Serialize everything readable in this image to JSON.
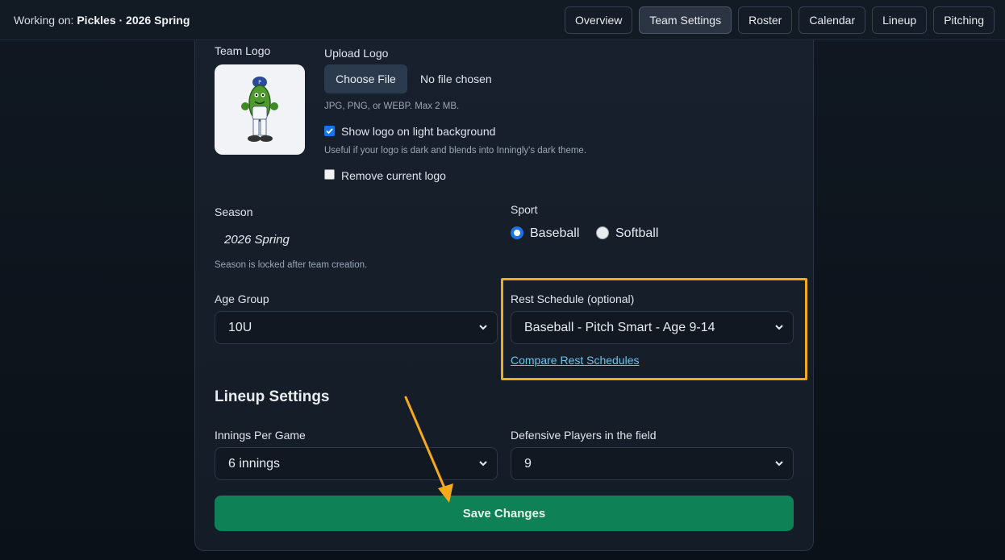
{
  "topbar": {
    "working_prefix": "Working on: ",
    "working_team": "Pickles · 2026 Spring",
    "nav": [
      {
        "label": "Overview",
        "active": false
      },
      {
        "label": "Team Settings",
        "active": true
      },
      {
        "label": "Roster",
        "active": false
      },
      {
        "label": "Calendar",
        "active": false
      },
      {
        "label": "Lineup",
        "active": false
      },
      {
        "label": "Pitching",
        "active": false
      }
    ]
  },
  "logo": {
    "label": "Team Logo",
    "upload_label": "Upload Logo",
    "choose_button": "Choose File",
    "file_status": "No file chosen",
    "formats_help": "JPG, PNG, or WEBP. Max 2 MB.",
    "light_bg_label": "Show logo on light background",
    "light_bg_checked": true,
    "light_bg_help": "Useful if your logo is dark and blends into Inningly's dark theme.",
    "remove_label": "Remove current logo",
    "remove_checked": false
  },
  "season": {
    "label": "Season",
    "value": "2026 Spring",
    "help": "Season is locked after team creation."
  },
  "sport": {
    "label": "Sport",
    "options": [
      {
        "label": "Baseball",
        "selected": true
      },
      {
        "label": "Softball",
        "selected": false
      }
    ]
  },
  "age_group": {
    "label": "Age Group",
    "value": "10U"
  },
  "rest_schedule": {
    "label": "Rest Schedule (optional)",
    "value": "Baseball - Pitch Smart - Age 9-14",
    "compare_link": "Compare Rest Schedules"
  },
  "lineup_settings": {
    "title": "Lineup Settings",
    "innings_label": "Innings Per Game",
    "innings_value": "6 innings",
    "players_label": "Defensive Players in the field",
    "players_value": "9"
  },
  "save_button": "Save Changes",
  "colors": {
    "accent_highlight": "#f6a91b",
    "save_green": "#0e8157",
    "link_blue": "#6fc2e8",
    "check_blue": "#1a73e8"
  }
}
